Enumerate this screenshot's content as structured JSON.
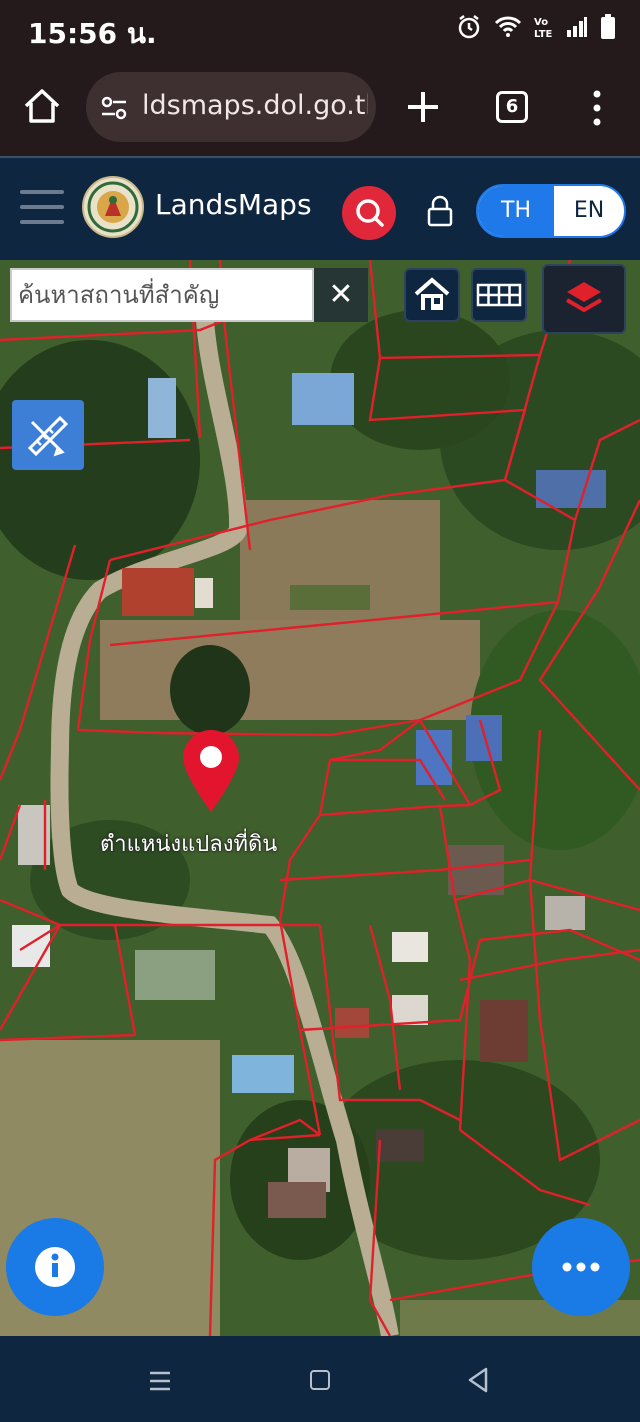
{
  "status_bar": {
    "time": "15:56 น.",
    "icons": [
      "alarm-icon",
      "wifi-icon",
      "volte-icon",
      "signal-icon",
      "battery-icon"
    ]
  },
  "browser": {
    "url": "ldsmaps.dol.go.th",
    "tab_count": "6"
  },
  "app": {
    "title": "LandsMaps",
    "lang": {
      "th": "TH",
      "en": "EN",
      "active": "TH"
    }
  },
  "map": {
    "search_placeholder": "ค้นหาสถานที่สำคัญ",
    "clear_label": "✕",
    "pin_label": "ตำแหน่งแปลงที่ดิน",
    "colors": {
      "parcel_line": "#e0202a",
      "pin": "#e3152e",
      "fab": "#1a7ae6"
    }
  },
  "nav": {
    "icons": [
      "recent-apps-icon",
      "home-icon",
      "back-icon"
    ]
  }
}
